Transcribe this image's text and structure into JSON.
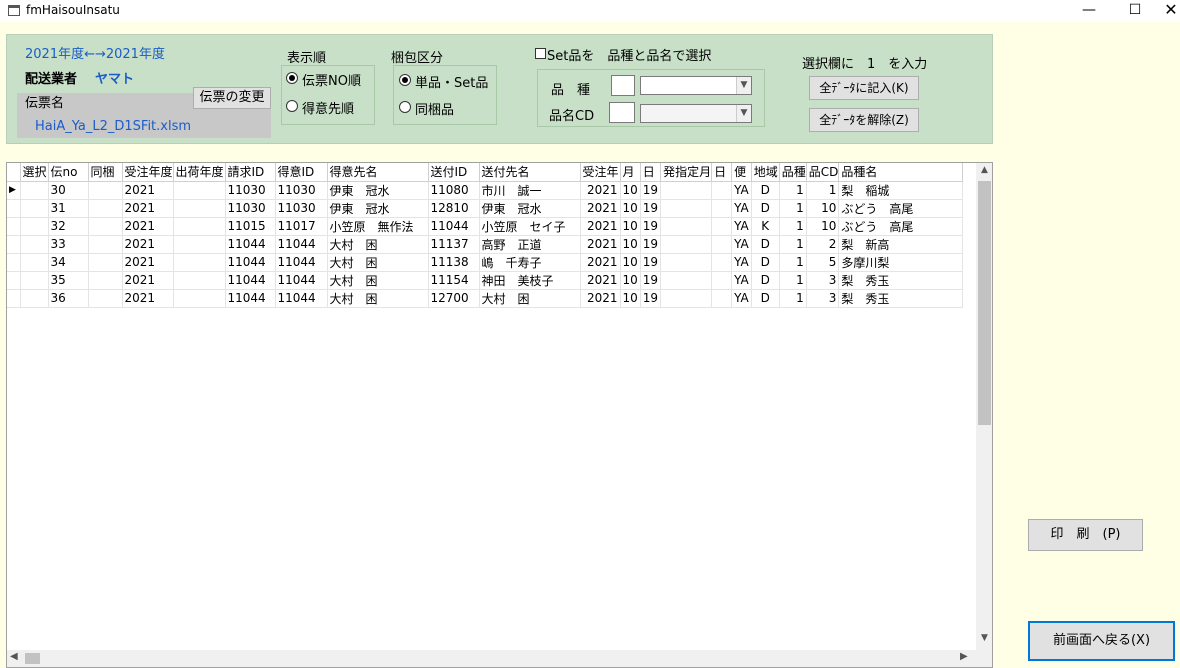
{
  "window": {
    "title": "fmHaisouInsatu",
    "minimize": "—",
    "maximize": "☐",
    "close": "✕"
  },
  "header": {
    "year_range": "2021年度←→2021年度",
    "carrier_label": "配送業者",
    "carrier_value": "ヤマト",
    "invoice_label": "伝票名",
    "change_invoice_button": "伝票の変更",
    "filename": "HaiA_Ya_L2_D1SFit.xlsm"
  },
  "sort_order": {
    "title": "表示順",
    "options": [
      {
        "label": "伝票NO順",
        "selected": true
      },
      {
        "label": "得意先順",
        "selected": false
      }
    ]
  },
  "packing": {
    "title": "梱包区分",
    "options": [
      {
        "label": "単品・Set品",
        "selected": true
      },
      {
        "label": "同梱品",
        "selected": false
      }
    ]
  },
  "set_select": {
    "checkbox_label": "Set品を　品種と品名で選択",
    "checked": false,
    "variety_label": "品　種",
    "product_cd_label": "品名CD",
    "variety_value": "",
    "product_cd_value": ""
  },
  "select_column": {
    "text": "選択欄に　1　を入力",
    "fill_all_button": "全ﾃﾞｰﾀに記入(K)",
    "clear_all_button": "全ﾃﾞｰﾀを解除(Z)"
  },
  "grid": {
    "columns": [
      "選択",
      "伝no",
      "同梱",
      "受注年度",
      "出荷年度",
      "請求ID",
      "得意ID",
      "得意先名",
      "送付ID",
      "送付先名",
      "受注年",
      "月",
      "日",
      "発指定月",
      "日",
      "便",
      "地域",
      "品種",
      "品CD",
      "品種名"
    ],
    "current_row_marker": "▶",
    "rows": [
      [
        "",
        "30",
        "",
        "2021",
        "",
        "11030",
        "11030",
        "伊東　冠水",
        "11080",
        "市川　誠一",
        "2021",
        "10",
        "19",
        "",
        "",
        "YA",
        "D",
        "1",
        "1",
        "梨　稲城"
      ],
      [
        "",
        "31",
        "",
        "2021",
        "",
        "11030",
        "11030",
        "伊東　冠水",
        "12810",
        "伊東　冠水",
        "2021",
        "10",
        "19",
        "",
        "",
        "YA",
        "D",
        "1",
        "10",
        "ぶどう　高尾"
      ],
      [
        "",
        "32",
        "",
        "2021",
        "",
        "11015",
        "11017",
        "小笠原　無作法",
        "11044",
        "小笠原　セイ子",
        "2021",
        "10",
        "19",
        "",
        "",
        "YA",
        "K",
        "1",
        "10",
        "ぶどう　高尾"
      ],
      [
        "",
        "33",
        "",
        "2021",
        "",
        "11044",
        "11044",
        "大村　困",
        "11137",
        "高野　正道",
        "2021",
        "10",
        "19",
        "",
        "",
        "YA",
        "D",
        "1",
        "2",
        "梨　新高"
      ],
      [
        "",
        "34",
        "",
        "2021",
        "",
        "11044",
        "11044",
        "大村　困",
        "11138",
        "嶋　千寿子",
        "2021",
        "10",
        "19",
        "",
        "",
        "YA",
        "D",
        "1",
        "5",
        "多摩川梨"
      ],
      [
        "",
        "35",
        "",
        "2021",
        "",
        "11044",
        "11044",
        "大村　困",
        "11154",
        "神田　美枝子",
        "2021",
        "10",
        "19",
        "",
        "",
        "YA",
        "D",
        "1",
        "3",
        "梨　秀玉"
      ],
      [
        "",
        "36",
        "",
        "2021",
        "",
        "11044",
        "11044",
        "大村　困",
        "12700",
        "大村　困",
        "2021",
        "10",
        "19",
        "",
        "",
        "YA",
        "D",
        "1",
        "3",
        "梨　秀玉"
      ]
    ]
  },
  "actions": {
    "print_button": "印　刷　(P)",
    "back_button": "前画面へ戻る(X)"
  }
}
